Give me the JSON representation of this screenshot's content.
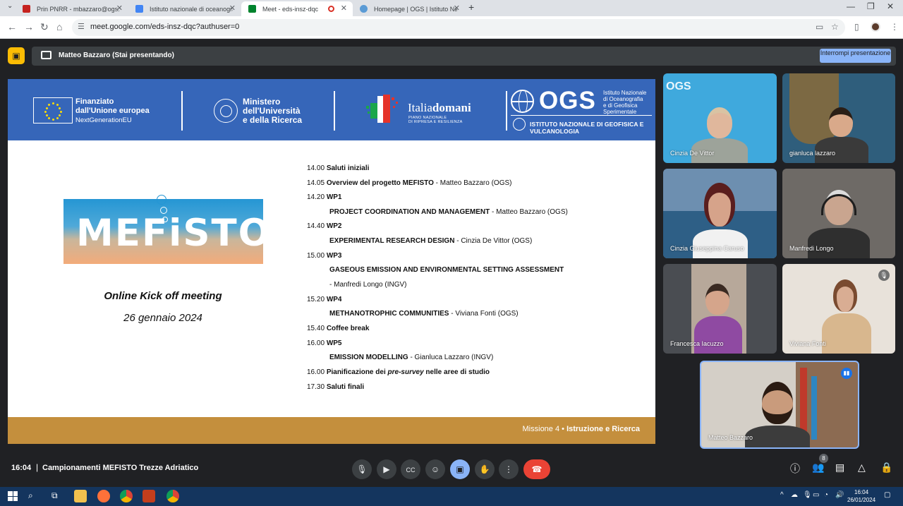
{
  "browser": {
    "tabs": [
      {
        "title": "Prin PNRR - mbazzaro@ogs.it -",
        "favicon_color": "#c5221f",
        "active": false
      },
      {
        "title": "Istituto nazionale di oceanograf",
        "favicon_color": "#4285f4",
        "active": false
      },
      {
        "title": "Meet - eds-insz-dqc",
        "favicon_color": "#00832d",
        "active": true,
        "recording": true
      },
      {
        "title": "Homepage | OGS | Istituto Nazi",
        "favicon_color": "#5b9bd5",
        "active": false
      }
    ],
    "url": "meet.google.com/eds-insz-dqc?authuser=0"
  },
  "meet": {
    "presenter_banner": "Matteo Bazzaro (Stai presentando)",
    "stop_presenting_label": "Interrompi presentazione",
    "time": "16:04",
    "meeting_name": "Campionamenti MEFISTO Trezze Adriatico",
    "participant_count": "8",
    "accent_color": "#8ab4f8",
    "end_call_color": "#ea4335"
  },
  "slide": {
    "header": {
      "eu_line1": "Finanziato",
      "eu_line2": "dall'Unione europea",
      "eu_line3": "NextGenerationEU",
      "mur_line1": "Ministero",
      "mur_line2": "dell'Università",
      "mur_line3": "e della Ricerca",
      "italia_a": "Italia",
      "italia_b": "domani",
      "italia_sub1": "PIANO NAZIONALE",
      "italia_sub2": "DI RIPRESA E RESILIENZA",
      "ogs_big": "OGS",
      "ogs_inst1": "Istituto Nazionale",
      "ogs_inst2": "di Oceanografia",
      "ogs_inst3": "e di Geofisica",
      "ogs_inst4": "Sperimentale",
      "ogs_full": "ISTITUTO NAZIONALE DI GEOFISICA E VULCANOLOGIA"
    },
    "logo_word": "MEFiSTO",
    "meeting_title": "Online Kick off meeting",
    "meeting_date": "26 gennaio 2024",
    "agenda": [
      {
        "time": "14.00",
        "bold": "Saluti iniziali",
        "rest": ""
      },
      {
        "time": "14.05",
        "bold": "Overview del progetto MEFISTO",
        "rest": " - Matteo Bazzaro (OGS)"
      },
      {
        "time": "14.20",
        "bold": "WP1",
        "rest": ""
      },
      {
        "time": "",
        "bold": "PROJECT COORDINATION AND MANAGEMENT",
        "rest": " - Matteo Bazzaro (OGS)"
      },
      {
        "time": "14.40",
        "bold": "WP2",
        "rest": ""
      },
      {
        "time": "",
        "bold": "EXPERIMENTAL RESEARCH DESIGN",
        "rest": " - Cinzia De Vittor (OGS)"
      },
      {
        "time": "15.00",
        "bold": "WP3",
        "rest": ""
      },
      {
        "time": "",
        "bold": "GASEOUS EMISSION AND ENVIRONMENTAL SETTING ASSESSMENT",
        "rest": ""
      },
      {
        "time": "",
        "bold": "",
        "rest": " - Manfredi Longo   (INGV)"
      },
      {
        "time": "15.20",
        "bold": "WP4",
        "rest": ""
      },
      {
        "time": "",
        "bold": "METHANOTROPHIC COMMUNITIES",
        "rest": " - Viviana Fonti (OGS)"
      },
      {
        "time": "15.40",
        "bold": "Coffee break",
        "rest": ""
      },
      {
        "time": "16.00",
        "bold": "WP5",
        "rest": ""
      },
      {
        "time": "",
        "bold": "EMISSION MODELLING",
        "rest": " - Gianluca Lazzaro (INGV)"
      },
      {
        "time": "16.00",
        "bold": "Pianificazione dei ",
        "italic": "pre-survey",
        "bold2": " nelle aree di studio",
        "rest": ""
      },
      {
        "time": "17.30",
        "bold": "Saluti finali",
        "rest": ""
      }
    ],
    "footer_plain": "Missione 4 • ",
    "footer_bold": "Istruzione e Ricerca",
    "header_color": "#3666b9",
    "footer_color": "#c48f3d"
  },
  "participants": [
    {
      "name": "Cinzia De Vittor",
      "bg": "#3fa9dd"
    },
    {
      "name": "gianluca lazzaro",
      "bg": "#2f5e7c"
    },
    {
      "name": "Cinzia Giuseppina Caruso",
      "bg": "#6d8fb0"
    },
    {
      "name": "Manfredi Longo",
      "bg": "#6e6a66"
    },
    {
      "name": "Francesca Iacuzzo",
      "bg": "#4a4d52"
    },
    {
      "name": "Viviana Fonti",
      "bg": "#e8e2da",
      "muted": true
    },
    {
      "name": "Matteo Bazzaro",
      "bg": "#d4cfc7",
      "speaking": true
    }
  ],
  "taskbar": {
    "clock_time": "16:04",
    "clock_date": "26/01/2024"
  }
}
